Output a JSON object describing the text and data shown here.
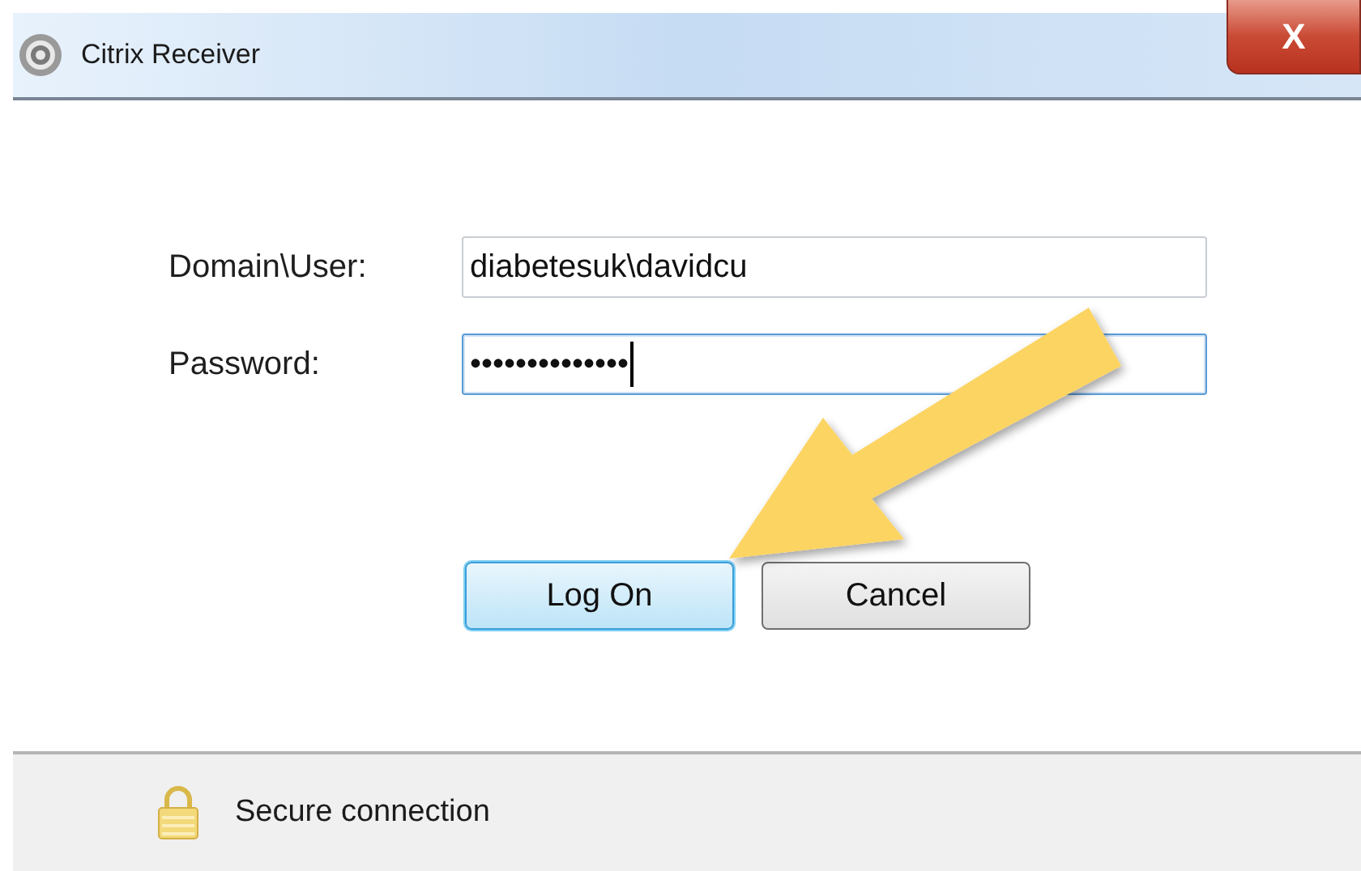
{
  "window": {
    "title": "Citrix Receiver",
    "close_label": "X"
  },
  "fields": [
    {
      "label": "Domain\\User:",
      "value": "diabetesuk\\davidcu",
      "focused": false
    },
    {
      "label": "Password:",
      "value": "••••••••••••••",
      "focused": true
    }
  ],
  "buttons": [
    {
      "label": "Log On",
      "default": true
    },
    {
      "label": "Cancel",
      "default": false
    }
  ],
  "status_bar": {
    "text": "Secure connection"
  }
}
